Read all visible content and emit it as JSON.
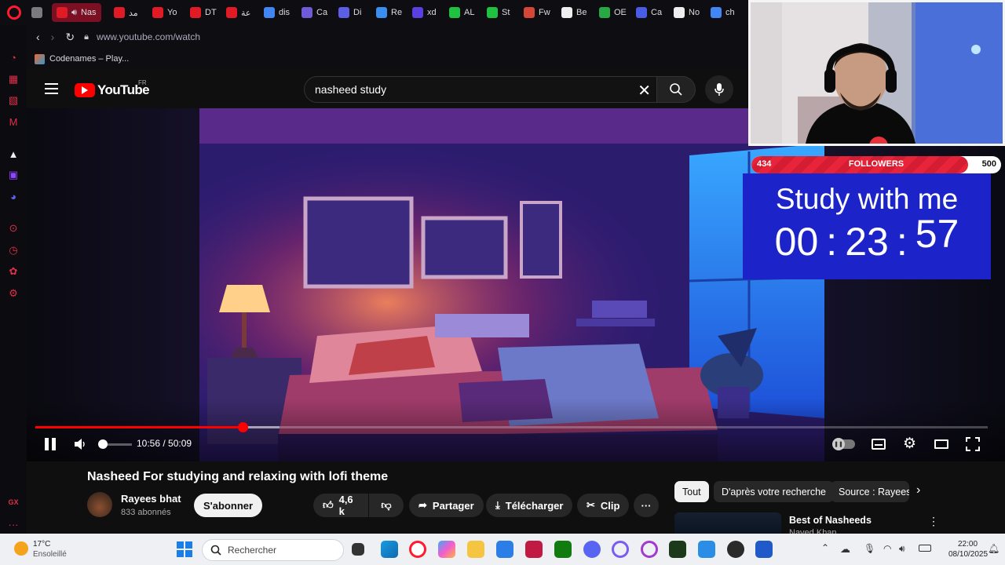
{
  "tabs": [
    {
      "label": "",
      "color": "#7a7a80"
    },
    {
      "label": "Nas",
      "color": "#e01b24",
      "active": true
    },
    {
      "label": "مد",
      "color": "#e01b24"
    },
    {
      "label": "Yo",
      "color": "#e01b24"
    },
    {
      "label": "DT",
      "color": "#e01b24"
    },
    {
      "label": "عة",
      "color": "#e01b24"
    },
    {
      "label": "dis",
      "color": "#4285f4"
    },
    {
      "label": "Ca",
      "color": "#6f5bd6"
    },
    {
      "label": "Di",
      "color": "#5c5fe6"
    },
    {
      "label": "Re",
      "color": "#3a8ef0"
    },
    {
      "label": "xd",
      "color": "#5b3fe0"
    },
    {
      "label": "AL",
      "color": "#20c040"
    },
    {
      "label": "St",
      "color": "#20c040"
    },
    {
      "label": "Fw",
      "color": "#d44638"
    },
    {
      "label": "Be",
      "color": "#eeeeee"
    },
    {
      "label": "OE",
      "color": "#28a745"
    },
    {
      "label": "Ca",
      "color": "#4a5be6"
    },
    {
      "label": "No",
      "color": "#eeeeee"
    },
    {
      "label": "ch",
      "color": "#4285f4"
    }
  ],
  "address": {
    "url": "www.youtube.com/watch"
  },
  "bookmarks": [
    {
      "label": "Codenames – Play..."
    }
  ],
  "youtube": {
    "logo_text": "YouTube",
    "region": "FR",
    "search_value": "nasheed study"
  },
  "player": {
    "time": "10:56 / 50:09",
    "progress_fraction": 0.218,
    "buffer_fraction": 0.256,
    "volume_fraction": 0.08
  },
  "overlay": {
    "followers_current": "434",
    "followers_label": "FOLLOWERS",
    "followers_goal": "500",
    "followers_fraction": 0.868,
    "timer_title": "Study with me",
    "timer_h": "00",
    "timer_m": "23",
    "timer_s": "57"
  },
  "video_info": {
    "title": "Nasheed For studying and relaxing with lofi theme",
    "channel": "Rayees bhat",
    "subscribers": "833 abonnés",
    "subscribe_label": "S'abonner",
    "likes": "4,6 k",
    "share_label": "Partager",
    "download_label": "Télécharger",
    "clip_label": "Clip"
  },
  "chips": [
    {
      "label": "Tout"
    },
    {
      "label": "D'après votre recherche"
    },
    {
      "label": "Source : Rayees"
    }
  ],
  "recommendation": {
    "title": "Best of Nasheeds",
    "channel": "Naved Khan"
  },
  "taskbar": {
    "temperature": "17°C",
    "weather": "Ensoleillé",
    "search_placeholder": "Rechercher",
    "clock_time": "22:00",
    "clock_date": "08/10/2025"
  },
  "colors": {
    "accent": "#ff0000",
    "overlay_blue": "#1c24c9",
    "opera_red": "#e0304a"
  }
}
